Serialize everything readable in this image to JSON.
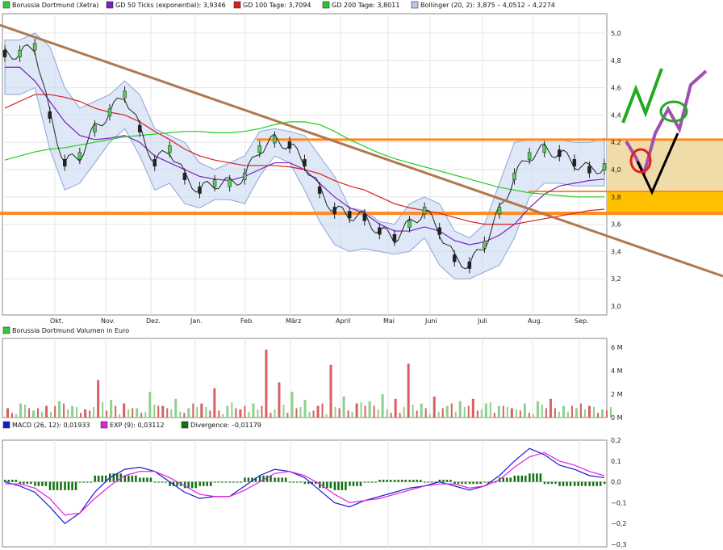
{
  "colors": {
    "price": "#222222",
    "gd50": "#7a1fc4",
    "gd100": "#d42020",
    "gd200": "#22cc22",
    "bollinger_fill": "#c8d8f0",
    "bollinger_line": "#8aa6d8",
    "trend": "#b07850",
    "support": "#ff8a20",
    "volume_up": "#8ed08e",
    "volume_down": "#d86060",
    "macd": "#1a1ad0",
    "exp": "#e020e0",
    "divergence": "#107010"
  },
  "legend_main": [
    {
      "label": "Borussia Dortmund (Xetra)",
      "swatch": "#33cc33"
    },
    {
      "label": "GD 50 Ticks (exponential): 3,9346",
      "swatch": "#7a1fc4"
    },
    {
      "label": "GD 100 Tage: 3,7094",
      "swatch": "#d42020"
    },
    {
      "label": "GD 200 Tage: 3,8011",
      "swatch": "#22cc22"
    },
    {
      "label": "Bollinger (20, 2): 3,875 – 4,0512 – 4,2274",
      "swatch": "#b8c8e8"
    }
  ],
  "legend_volume": {
    "label": "Borussia Dortmund Volumen in Euro",
    "swatch": "#33cc33"
  },
  "legend_macd": [
    {
      "label": "MACD (26, 12): 0,01933",
      "swatch": "#1a1ad0"
    },
    {
      "label": "EXP (9): 0,03112",
      "swatch": "#e020e0"
    },
    {
      "label": "Divergence: –0,01179",
      "swatch": "#107010"
    }
  ],
  "chart_data": [
    {
      "type": "line",
      "name": "price",
      "ylim": [
        3.0,
        5.0
      ],
      "yticks": [
        "5,0",
        "4,8",
        "4,6",
        "4,4",
        "4,2",
        "4,0",
        "3,8",
        "3,6",
        "3,4",
        "3,2",
        "3,0"
      ],
      "ytick_values": [
        5.0,
        4.8,
        4.6,
        4.4,
        4.2,
        4.0,
        3.8,
        3.6,
        3.4,
        3.2,
        3.0
      ],
      "months": [
        "Okt.",
        "Nov.",
        "Dez.",
        "Jan.",
        "Feb.",
        "März",
        "April",
        "Mai",
        "Juni",
        "Juli",
        "Aug.",
        "Sep."
      ],
      "series": [
        {
          "name": "Borussia Dortmund (Xetra)",
          "values": [
            4.85,
            4.85,
            4.9,
            4.4,
            4.05,
            4.1,
            4.3,
            4.42,
            4.55,
            4.3,
            4.05,
            4.15,
            3.95,
            3.85,
            3.9,
            3.9,
            3.95,
            4.15,
            4.22,
            4.18,
            4.05,
            3.85,
            3.7,
            3.67,
            3.65,
            3.55,
            3.5,
            3.6,
            3.7,
            3.55,
            3.35,
            3.3,
            3.45,
            3.7,
            3.95,
            4.1,
            4.15,
            4.12,
            4.05,
            4.0,
            4.02
          ]
        },
        {
          "name": "GD 50 Ticks (exponential): 3,9346",
          "values": [
            4.75,
            4.75,
            4.65,
            4.5,
            4.35,
            4.25,
            4.22,
            4.23,
            4.25,
            4.2,
            4.1,
            4.05,
            4.0,
            3.95,
            3.93,
            3.92,
            3.95,
            4.0,
            4.05,
            4.05,
            4.0,
            3.9,
            3.8,
            3.72,
            3.68,
            3.6,
            3.55,
            3.55,
            3.58,
            3.55,
            3.48,
            3.45,
            3.47,
            3.52,
            3.6,
            3.72,
            3.82,
            3.88,
            3.9,
            3.92,
            3.93
          ]
        },
        {
          "name": "GD 100 Tage: 3,7094",
          "values": [
            4.45,
            4.5,
            4.55,
            4.55,
            4.53,
            4.5,
            4.45,
            4.42,
            4.4,
            4.35,
            4.28,
            4.22,
            4.15,
            4.1,
            4.07,
            4.05,
            4.03,
            4.03,
            4.03,
            4.02,
            4.0,
            3.97,
            3.92,
            3.88,
            3.85,
            3.8,
            3.75,
            3.72,
            3.7,
            3.68,
            3.65,
            3.62,
            3.6,
            3.6,
            3.6,
            3.62,
            3.64,
            3.66,
            3.68,
            3.7,
            3.71
          ]
        },
        {
          "name": "GD 200 Tage: 3,8011",
          "values": [
            4.07,
            4.1,
            4.13,
            4.15,
            4.16,
            4.18,
            4.2,
            4.22,
            4.24,
            4.25,
            4.26,
            4.27,
            4.28,
            4.28,
            4.27,
            4.27,
            4.28,
            4.3,
            4.33,
            4.35,
            4.35,
            4.33,
            4.28,
            4.22,
            4.17,
            4.12,
            4.08,
            4.05,
            4.02,
            3.99,
            3.96,
            3.93,
            3.9,
            3.87,
            3.85,
            3.83,
            3.82,
            3.81,
            3.8,
            3.8,
            3.8
          ]
        }
      ],
      "bollinger_upper": [
        4.95,
        4.95,
        5.0,
        4.9,
        4.6,
        4.45,
        4.5,
        4.55,
        4.65,
        4.55,
        4.3,
        4.25,
        4.2,
        4.05,
        4.0,
        4.05,
        4.1,
        4.28,
        4.3,
        4.28,
        4.25,
        4.1,
        3.95,
        3.72,
        3.7,
        3.62,
        3.6,
        3.75,
        3.8,
        3.75,
        3.55,
        3.5,
        3.6,
        3.9,
        4.2,
        4.22,
        4.22,
        4.22,
        4.2,
        4.2,
        4.23
      ],
      "bollinger_lower": [
        4.55,
        4.55,
        4.6,
        4.15,
        3.85,
        3.9,
        4.05,
        4.2,
        4.3,
        4.1,
        3.85,
        3.9,
        3.75,
        3.72,
        3.78,
        3.78,
        3.75,
        3.95,
        4.1,
        4.05,
        3.85,
        3.62,
        3.45,
        3.4,
        3.42,
        3.4,
        3.38,
        3.4,
        3.5,
        3.3,
        3.2,
        3.2,
        3.25,
        3.3,
        3.5,
        3.8,
        3.9,
        3.9,
        3.88,
        3.88,
        3.88
      ],
      "support_lines": [
        3.68,
        4.22,
        3.84
      ]
    },
    {
      "type": "bar",
      "name": "volume",
      "ylim": [
        0,
        6
      ],
      "yticks": [
        "6 M",
        "4 M",
        "2 M",
        "0 M"
      ],
      "ytick_values": [
        6,
        4,
        2,
        0
      ],
      "values": [
        0.8,
        1.2,
        0.6,
        1.0,
        1.4,
        1.0,
        0.7,
        3.2,
        1.5,
        1.2,
        0.8,
        2.2,
        1.0,
        1.6,
        0.8,
        1.2,
        2.5,
        1.0,
        0.7,
        1.2,
        5.8,
        3.0,
        2.2,
        1.5,
        1.0,
        4.5,
        1.8,
        1.2,
        1.4,
        2.0,
        1.6,
        4.6,
        1.2,
        1.8,
        1.0,
        1.4,
        1.6,
        1.2,
        1.0,
        0.8,
        1.2,
        1.4,
        1.6,
        1.0,
        0.8,
        1.0,
        0.7
      ]
    },
    {
      "type": "line",
      "name": "macd",
      "ylim": [
        -0.3,
        0.2
      ],
      "yticks": [
        "0,2",
        "0,1",
        "0,0",
        "−0,1",
        "−0,2",
        "−0,3"
      ],
      "ytick_values": [
        0.2,
        0.1,
        0.0,
        -0.1,
        -0.2,
        -0.3
      ],
      "series": [
        {
          "name": "MACD (26, 12): 0,01933",
          "values": [
            0.0,
            -0.02,
            -0.05,
            -0.12,
            -0.2,
            -0.15,
            -0.05,
            0.02,
            0.06,
            0.07,
            0.05,
            0.0,
            -0.05,
            -0.08,
            -0.07,
            -0.07,
            -0.02,
            0.03,
            0.06,
            0.05,
            0.02,
            -0.04,
            -0.1,
            -0.12,
            -0.09,
            -0.07,
            -0.05,
            -0.03,
            -0.02,
            0.0,
            -0.02,
            -0.04,
            -0.02,
            0.03,
            0.1,
            0.16,
            0.13,
            0.08,
            0.06,
            0.03,
            0.02
          ]
        },
        {
          "name": "EXP (9): 0,03112",
          "values": [
            -0.01,
            -0.01,
            -0.03,
            -0.08,
            -0.16,
            -0.15,
            -0.08,
            -0.02,
            0.03,
            0.05,
            0.05,
            0.02,
            -0.02,
            -0.06,
            -0.07,
            -0.07,
            -0.04,
            0.0,
            0.04,
            0.05,
            0.03,
            -0.01,
            -0.06,
            -0.1,
            -0.09,
            -0.08,
            -0.06,
            -0.04,
            -0.02,
            -0.01,
            -0.01,
            -0.03,
            -0.02,
            0.01,
            0.07,
            0.12,
            0.14,
            0.1,
            0.08,
            0.05,
            0.03
          ]
        },
        {
          "name": "Divergence: –0,01179",
          "values": [
            0.01,
            -0.01,
            -0.02,
            -0.04,
            -0.04,
            0.0,
            0.03,
            0.04,
            0.03,
            0.02,
            0.0,
            -0.02,
            -0.03,
            -0.02,
            0.0,
            0.0,
            0.02,
            0.03,
            0.02,
            0.0,
            -0.01,
            -0.03,
            -0.04,
            -0.02,
            0.0,
            0.01,
            0.01,
            0.01,
            0.0,
            0.01,
            -0.01,
            -0.01,
            0.0,
            0.02,
            0.03,
            0.04,
            -0.01,
            -0.02,
            -0.02,
            -0.02,
            -0.01
          ]
        }
      ]
    }
  ]
}
